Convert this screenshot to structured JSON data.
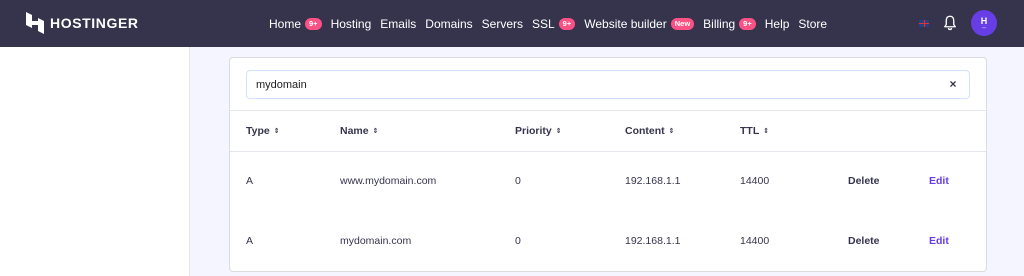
{
  "brand": {
    "name": "HOSTINGER"
  },
  "nav": [
    {
      "label": "Home",
      "badge": "9+"
    },
    {
      "label": "Hosting",
      "badge": null
    },
    {
      "label": "Emails",
      "badge": null
    },
    {
      "label": "Domains",
      "badge": null
    },
    {
      "label": "Servers",
      "badge": null
    },
    {
      "label": "SSL",
      "badge": "9+"
    },
    {
      "label": "Website builder",
      "badge": "New"
    },
    {
      "label": "Billing",
      "badge": "9+"
    },
    {
      "label": "Help",
      "badge": null
    },
    {
      "label": "Store",
      "badge": null
    }
  ],
  "header_icons": {
    "flag": "uk-flag-icon",
    "bell": "bell-icon",
    "avatar_letter": "H"
  },
  "search": {
    "value": "mydomain",
    "clear_icon": "×"
  },
  "table": {
    "columns": [
      "Type",
      "Name",
      "Priority",
      "Content",
      "TTL"
    ],
    "sort_icon": "⇕",
    "rows": [
      {
        "type": "A",
        "name": "www.mydomain.com",
        "priority": "0",
        "content": "192.168.1.1",
        "ttl": "14400",
        "delete": "Delete",
        "edit": "Edit"
      },
      {
        "type": "A",
        "name": "mydomain.com",
        "priority": "0",
        "content": "192.168.1.1",
        "ttl": "14400",
        "delete": "Delete",
        "edit": "Edit"
      }
    ]
  },
  "colors": {
    "topbar": "#36344d",
    "accent": "#673de6",
    "badge": "#fc5185"
  }
}
